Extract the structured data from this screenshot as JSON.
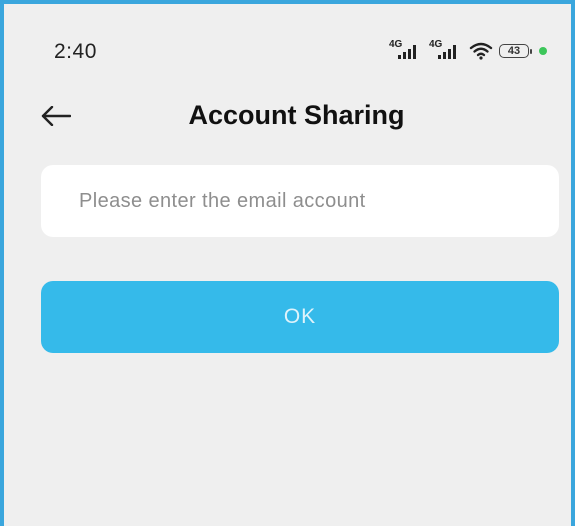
{
  "status_bar": {
    "time": "2:40",
    "network_1": "4G",
    "network_2": "4G",
    "battery_level": "43",
    "indicator_color": "#3cc65a"
  },
  "header": {
    "back_icon": "arrow-left-icon",
    "title": "Account Sharing"
  },
  "form": {
    "email_placeholder": "Please enter the email account",
    "email_value": "",
    "ok_label": "OK"
  },
  "colors": {
    "background": "#efefef",
    "primary_button": "#35baea",
    "frame_border": "#3aa6dd"
  }
}
